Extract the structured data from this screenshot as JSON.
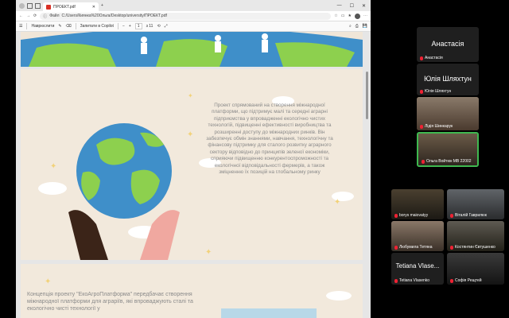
{
  "browser": {
    "tab_title": "ПРОЕКТ.pdf",
    "new_tab": "+",
    "window_controls": [
      "—",
      "☐",
      "✕"
    ],
    "site_label": "Файл",
    "address": "C:/Users/Киянка%20Ольга/Desktop/university/ПРОЕКТ.pdf",
    "toolbar": {
      "menu": "☰",
      "read_aloud": "Наврюслити",
      "draw": "✎",
      "erase": "⌫",
      "copilot": "Запитати в Copilot",
      "zoom_out": "−",
      "zoom_in": "+",
      "page_current": "1",
      "page_total": "з 11"
    }
  },
  "pdf": {
    "page2_text": "Проект спрямований на створення міжнародної платформи, що підтримує малі та середні аграрні підприємства у впровадженні екологічно чистих технологій, підвищенні ефективності виробництва та розширенні доступу до міжнародних ринків. Він забезпечує обмін знаннями, навчання, технологічну та фінансову підтримку для сталого розвитку аграрного сектору відповідно до принципів зеленої економіки, сприяючи підвищенню конкурентоспроможності та екологічної відповідальності фермерів, а також зміцненню їх позицій на глобальному ринку",
    "page3_text": "Концепція проекту \"ЕкоАгроПлатформа\" передбачає створення міжнародної платформи для аграріїв, які впроваджують сталі та екологічно чисті технології у"
  },
  "participants": [
    {
      "name_big": "Анастасія",
      "name": "Анастасія",
      "muted": true,
      "video": false
    },
    {
      "name_big": "Юлія Шляхтун",
      "name": "Юлія Шляхтун",
      "muted": true,
      "video": false
    },
    {
      "name": "Лідія Шинкарук",
      "muted": true,
      "video": true
    },
    {
      "name": "Ольга Войтюк МВ 22002",
      "muted": true,
      "video": true,
      "active": true
    },
    {
      "name": "borys maiovatyy",
      "muted": true,
      "video": true
    },
    {
      "name": "Віталій Гаврилюк",
      "muted": true,
      "video": true
    },
    {
      "name": "Любумила Тетяна",
      "muted": true,
      "video": true
    },
    {
      "name": "Костянтин Євтушенко",
      "muted": true,
      "video": true
    },
    {
      "name_big": "Tetiana Vlase...",
      "name": "Tetiana Vlasenko",
      "muted": true,
      "video": false
    },
    {
      "name": "Софія Рещтей",
      "muted": true,
      "video": true
    }
  ],
  "colors": {
    "accent_active": "#3fb950",
    "muted": "#e5333a",
    "pdf_bg": "#f2e9dc",
    "earth_blue": "#3f8fc9",
    "earth_green": "#8dd04e"
  }
}
